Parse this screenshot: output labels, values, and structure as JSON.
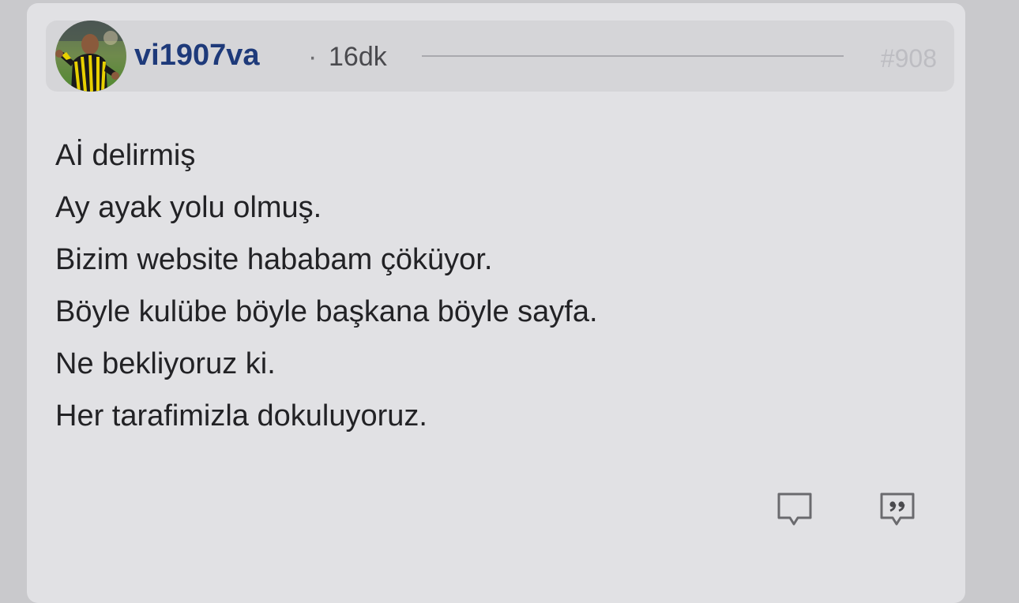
{
  "post": {
    "username": "vi1907va",
    "separator": "·",
    "time_ago": "16dk",
    "post_number": "#908",
    "lines": [
      "Aİ delirmiş",
      "Ay ayak yolu olmuş.",
      "Bizim website hababam çöküyor.",
      "Böyle kulübe böyle başkana böyle sayfa.",
      "Ne bekliyoruz ki.",
      "Her tarafimizla dokuluyoruz."
    ]
  },
  "icons": {
    "reply": "comment-icon",
    "quote": "quote-icon"
  },
  "colors": {
    "username": "#1e3a7a",
    "card_bg": "#e1e1e4",
    "header_bg": "#d5d5d8",
    "text": "#222225"
  }
}
